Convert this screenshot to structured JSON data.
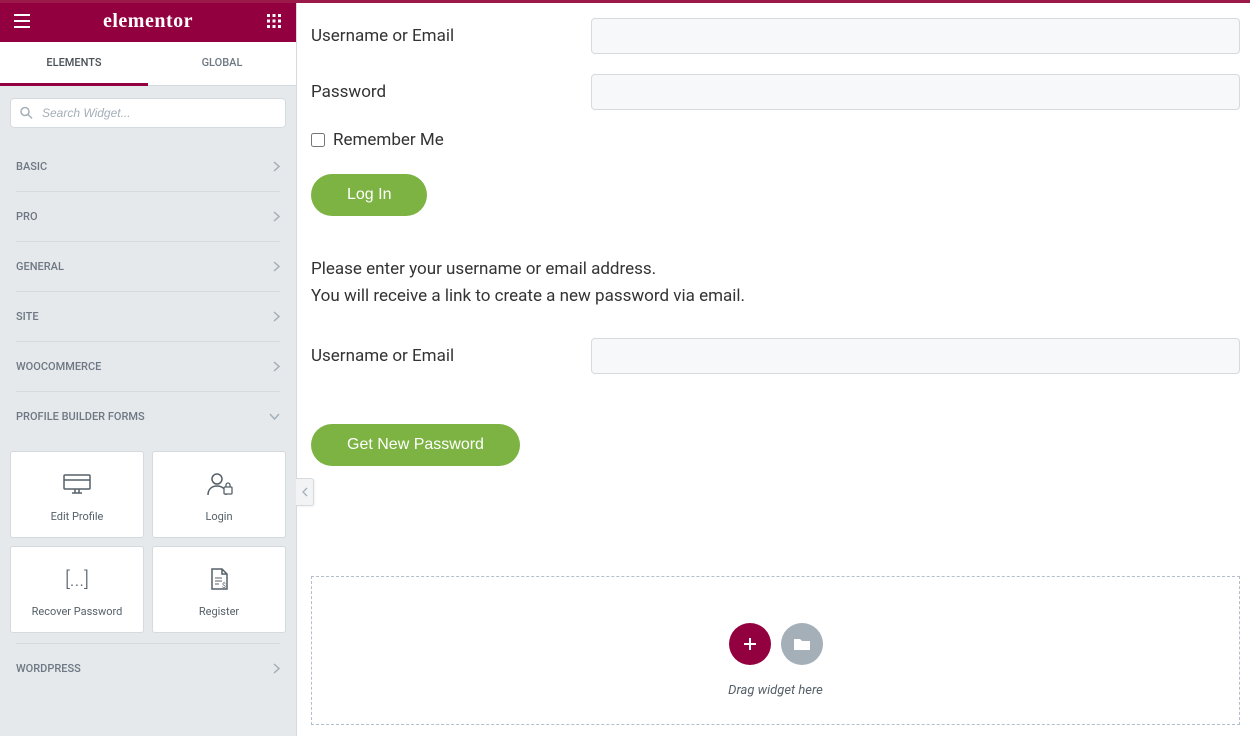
{
  "header": {
    "logo": "elementor"
  },
  "tabs": {
    "elements": "ELEMENTS",
    "global": "GLOBAL"
  },
  "search": {
    "placeholder": "Search Widget..."
  },
  "categories": [
    {
      "label": "BASIC",
      "open": false
    },
    {
      "label": "PRO",
      "open": false
    },
    {
      "label": "GENERAL",
      "open": false
    },
    {
      "label": "SITE",
      "open": false
    },
    {
      "label": "WOOCOMMERCE",
      "open": false
    },
    {
      "label": "PROFILE BUILDER FORMS",
      "open": true
    },
    {
      "label": "WORDPRESS",
      "open": false
    }
  ],
  "widgets": [
    {
      "icon": "edit-profile-icon",
      "label": "Edit Profile"
    },
    {
      "icon": "login-icon",
      "label": "Login"
    },
    {
      "icon": "recover-password-icon",
      "label": "Recover Password"
    },
    {
      "icon": "register-icon",
      "label": "Register"
    }
  ],
  "login_form": {
    "username_label": "Username or Email",
    "password_label": "Password",
    "remember_label": "Remember Me",
    "submit_label": "Log In"
  },
  "recover_form": {
    "help_line1": "Please enter your username or email address.",
    "help_line2": "You will receive a link to create a new password via email.",
    "username_label": "Username or Email",
    "submit_label": "Get New Password"
  },
  "dropzone": {
    "hint": "Drag widget here"
  },
  "colors": {
    "brand": "#93003f",
    "accent": "#7cb342"
  }
}
